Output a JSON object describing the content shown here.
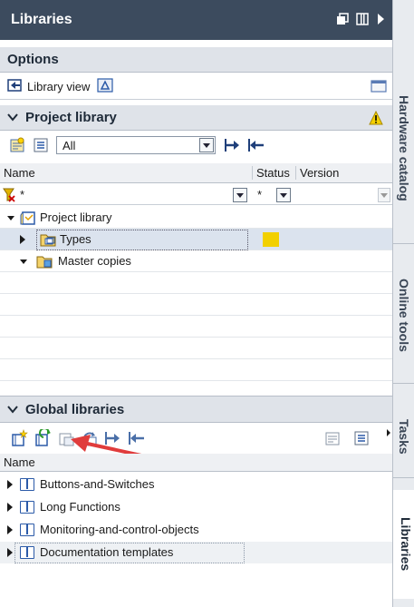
{
  "panel_title": "Libraries",
  "options": {
    "title": "Options",
    "library_view_label": "Library view"
  },
  "project_library": {
    "title": "Project library",
    "filter_value": "All",
    "columns": {
      "name": "Name",
      "status": "Status",
      "version": "Version"
    },
    "filter_row": {
      "name_filter": "*",
      "status_filter": "*"
    },
    "tree": {
      "root": "Project library",
      "types": "Types",
      "master_copies": "Master copies"
    }
  },
  "global_libraries": {
    "title": "Global libraries",
    "columns": {
      "name": "Name"
    },
    "items": [
      "Buttons-and-Switches",
      "Long Functions",
      "Monitoring-and-control-objects",
      "Documentation templates"
    ]
  },
  "sidebar_tabs": [
    "Hardware catalog",
    "Online tools",
    "Tasks",
    "Libraries"
  ],
  "colors": {
    "title_bg": "#3c4b5e",
    "section_bg": "#dfe3e9",
    "selected_row": "#dbe3ee",
    "status_yellow": "#f2d000",
    "arrow_red": "#e03c3c"
  }
}
